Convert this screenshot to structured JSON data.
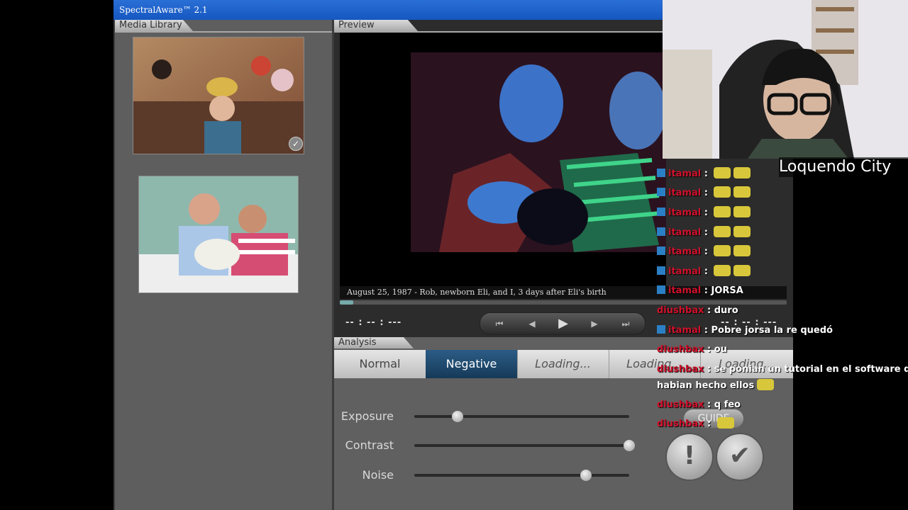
{
  "app": {
    "title": "SpectralAware™ 2.1",
    "library_tab": "Media Library",
    "preview_tab": "Preview",
    "analysis_tab": "Analysis"
  },
  "preview": {
    "caption": "August 25, 1987 - Rob, newborn Eli, and I, 3 days after Eli's birth",
    "timecode_left": "-- : -- : ---",
    "timecode_right": "-- : -- : ---",
    "progress": 0.03,
    "controls": [
      "skip-back",
      "step-back",
      "play",
      "step-forward",
      "skip-forward"
    ]
  },
  "analysis": {
    "modes": [
      {
        "label": "Normal",
        "state": "normal"
      },
      {
        "label": "Negative",
        "state": "active"
      },
      {
        "label": "Loading...",
        "state": "loading"
      },
      {
        "label": "Loading...",
        "state": "loading"
      },
      {
        "label": "Loading...",
        "state": "loading"
      }
    ],
    "sliders": [
      {
        "label": "Exposure",
        "value": 0.2
      },
      {
        "label": "Contrast",
        "value": 1.0
      },
      {
        "label": "Noise",
        "value": 0.8
      }
    ],
    "guide_label": "GUIDE",
    "alert_glyph": "!",
    "confirm_glyph": "✔"
  },
  "stream": {
    "streamer_name": "Loquendo City",
    "chat": [
      {
        "user": "itamal",
        "message": "",
        "badge": true,
        "emotes": 2
      },
      {
        "user": "itamal",
        "message": "",
        "badge": true,
        "emotes": 2
      },
      {
        "user": "itamal",
        "message": "",
        "badge": true,
        "emotes": 2
      },
      {
        "user": "itamal",
        "message": "",
        "badge": true,
        "emotes": 2
      },
      {
        "user": "itamal",
        "message": "",
        "badge": true,
        "emotes": 2
      },
      {
        "user": "itamal",
        "message": "",
        "badge": true,
        "emotes": 2
      },
      {
        "user": "itamal",
        "message": "JORSA",
        "badge": true,
        "emotes": 0
      },
      {
        "user": "diushbax",
        "message": "duro",
        "badge": false,
        "emotes": 0
      },
      {
        "user": "itamal",
        "message": "Pobre jorsa la re quedó",
        "badge": true,
        "emotes": 0
      },
      {
        "user": "diushbax",
        "message": "ou",
        "badge": false,
        "emotes": 0
      },
      {
        "user": "diushbax",
        "message": "se ponian un tutorial en el software que",
        "badge": false,
        "emotes": 0
      },
      {
        "user": "",
        "message": "habian hecho ellos",
        "badge": false,
        "emotes": 1
      },
      {
        "user": "diushbax",
        "message": "q feo",
        "badge": false,
        "emotes": 0
      },
      {
        "user": "diushbax",
        "message": "",
        "badge": false,
        "emotes": 1
      }
    ]
  },
  "colors": {
    "title_bar": "#1a5fd0",
    "active_mode": "#1f4a6e",
    "chat_user": "#d0112b"
  }
}
